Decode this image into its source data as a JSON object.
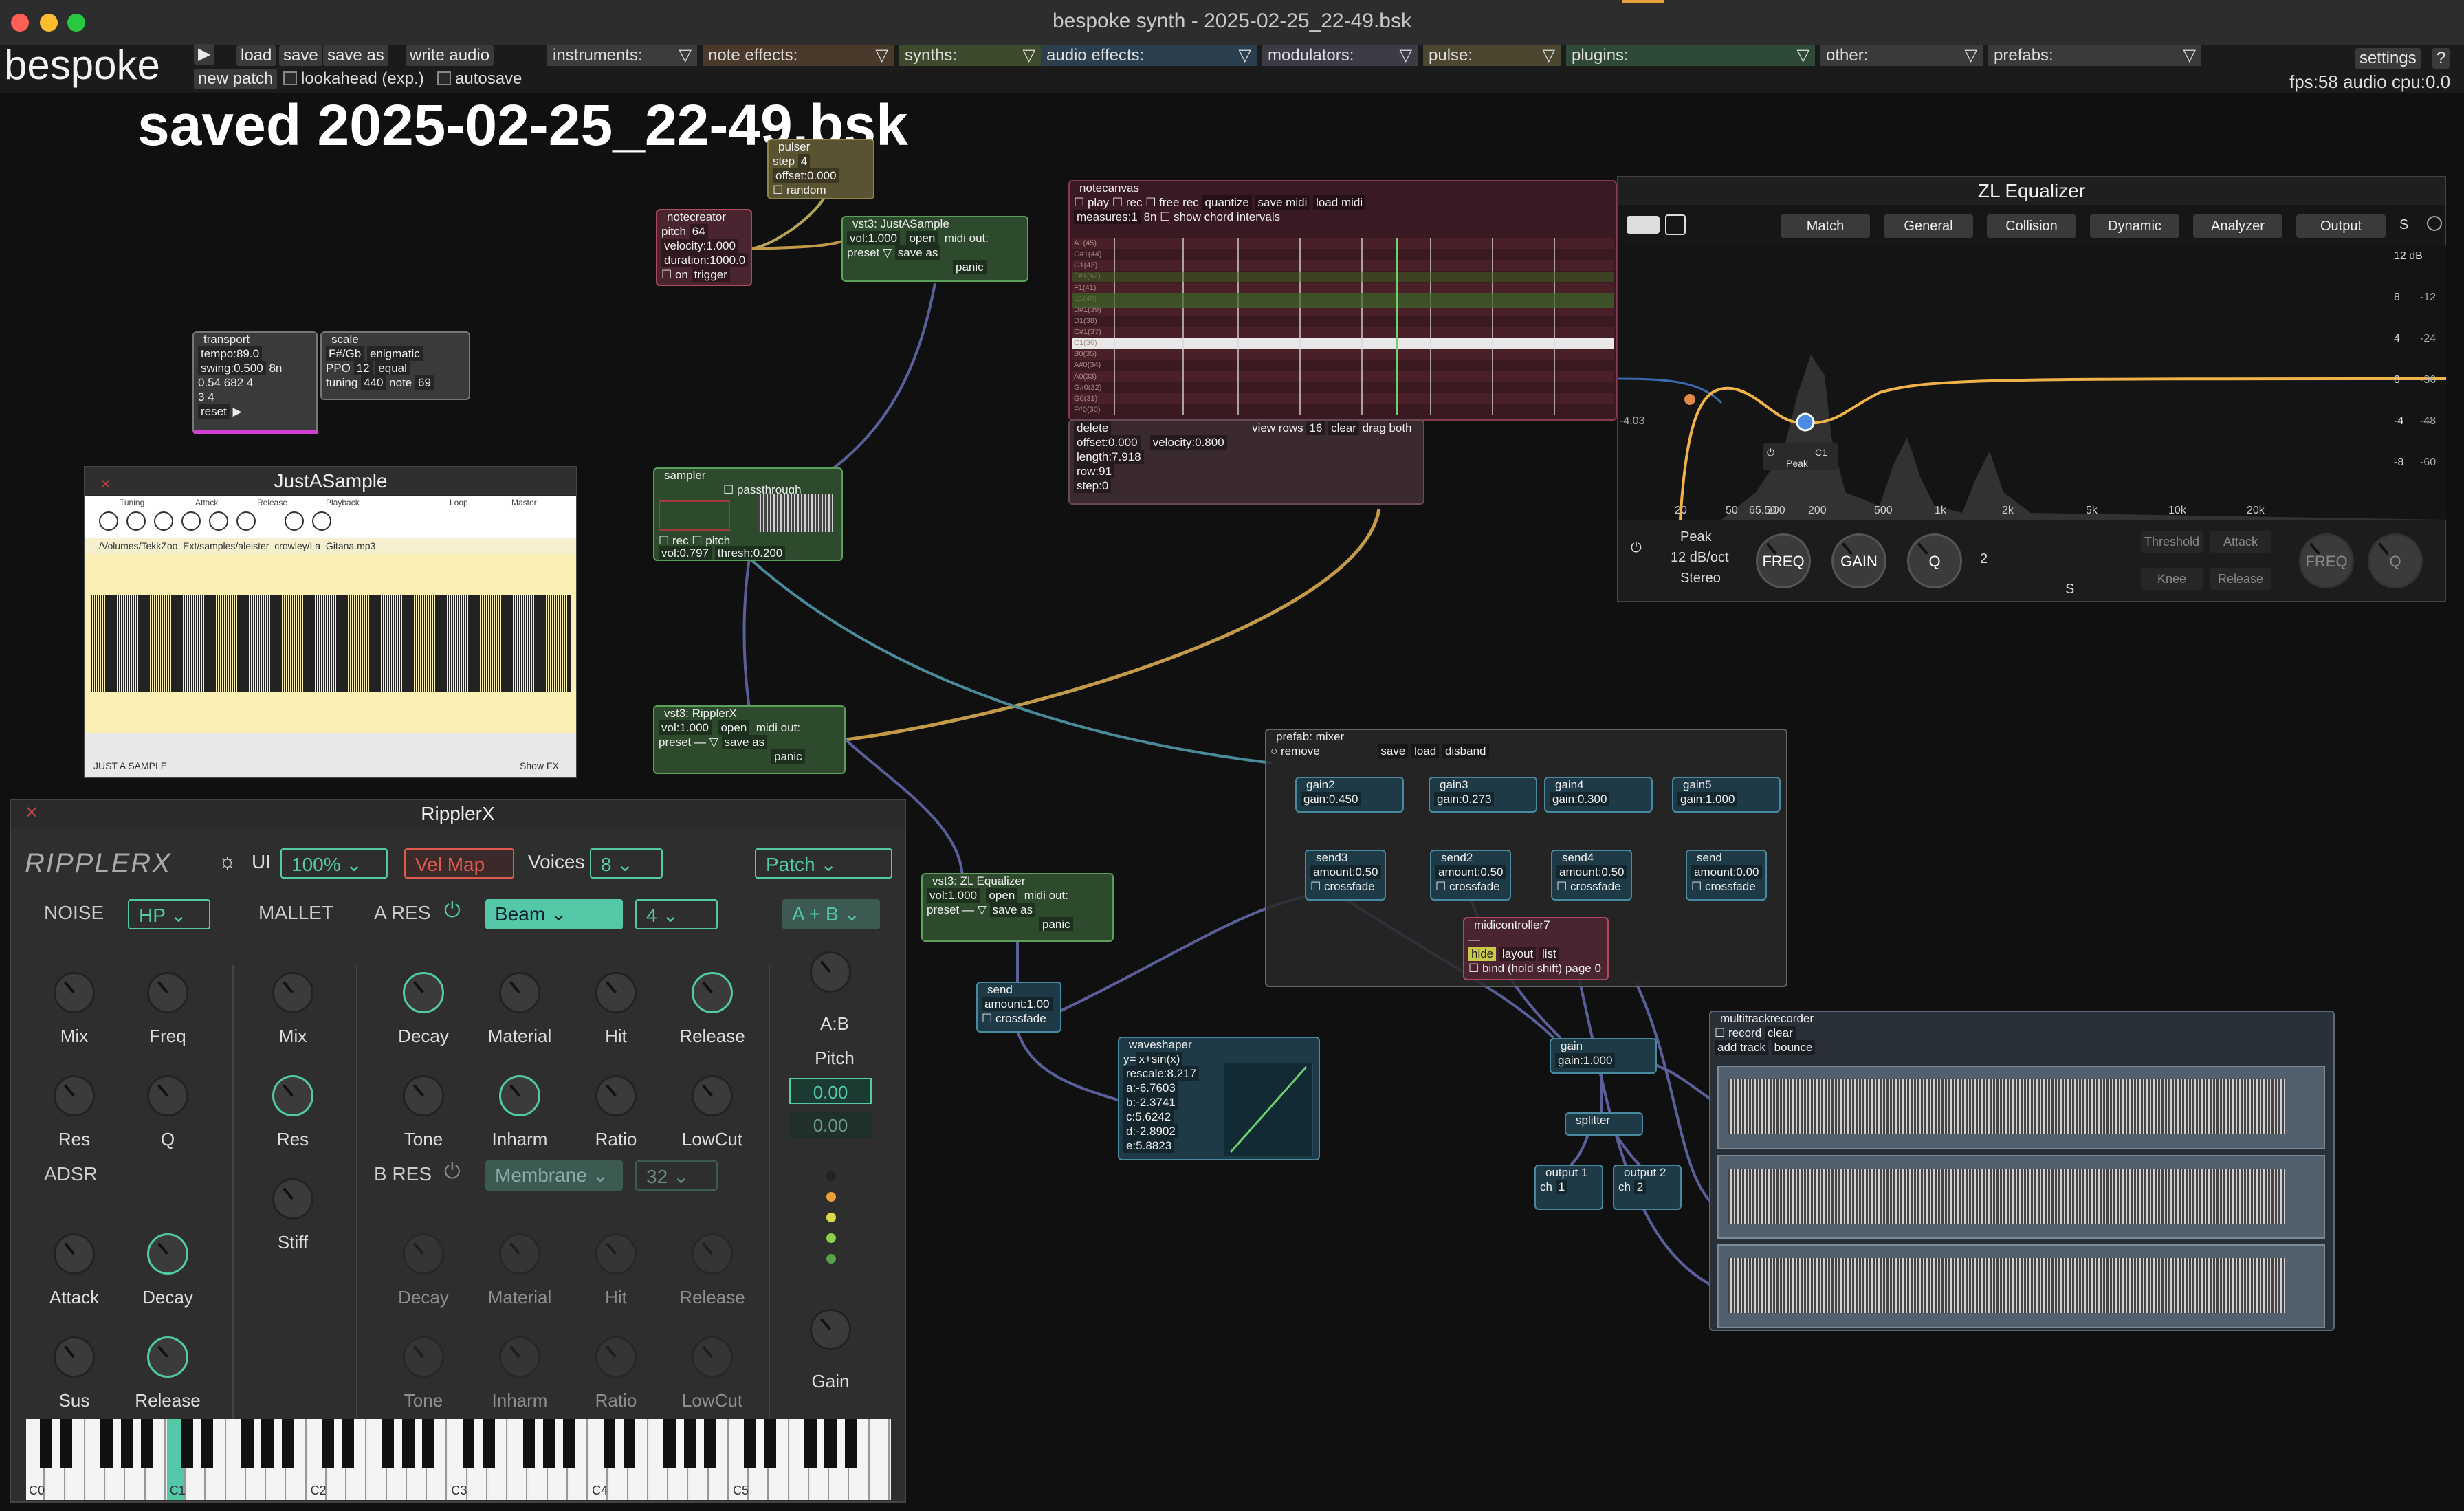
{
  "window": {
    "title": "bespoke synth - 2025-02-25_22-49.bsk"
  },
  "toolbar": {
    "logo": "bespoke",
    "play_icon": "play-icon",
    "load": "load",
    "save": "save",
    "save_as": "save as",
    "write_audio": "write audio",
    "new_patch": "new patch",
    "lookahead": "lookahead (exp.)",
    "autosave": "autosave",
    "menus": [
      "instruments:",
      "note effects:",
      "synths:",
      "audio effects:",
      "modulators:",
      "pulse:",
      "plugins:",
      "other:",
      "prefabs:"
    ],
    "settings": "settings",
    "help": "?",
    "stats": "fps:58  audio cpu:0.0"
  },
  "canvas": {
    "saved_banner": "saved 2025-02-25_22-49.bsk"
  },
  "modules": {
    "pulser": {
      "title": "pulser",
      "step": "step",
      "step_val": "4",
      "offset": "offset:0.000",
      "random": "random"
    },
    "notecreator": {
      "title": "notecreator",
      "pitch": "pitch",
      "pitch_val": "64",
      "velocity": "velocity:1.000",
      "duration": "duration:1000.0",
      "on": "on",
      "trigger": "trigger"
    },
    "vst_justasample": {
      "title": "vst3: JustASample",
      "vol": "vol:1.000",
      "open": "open",
      "midi_out": "midi out:",
      "preset": "preset",
      "save_as": "save as",
      "panic": "panic"
    },
    "transport": {
      "title": "transport",
      "tempo": "tempo:89.0",
      "swing": "swing:0.500",
      "swing_div": "8n",
      "val1": "0.54 682",
      "val2": "3",
      "n1": "4",
      "n2": "4",
      "reset": "reset"
    },
    "scale": {
      "title": "scale",
      "root": "F#/Gb",
      "mode": "enigmatic",
      "ppo": "PPO",
      "ppo_val": "12",
      "tuning_sys": "equal",
      "tuning": "tuning",
      "tuning_val": "440",
      "note": "note",
      "note_val": "69"
    },
    "sampler": {
      "title": "sampler",
      "passthrough": "passthrough",
      "rec": "rec",
      "pitch": "pitch",
      "vol": "vol:0.797",
      "thresh": "thresh:0.200"
    },
    "vst_ripplerx": {
      "title": "vst3: RipplerX",
      "vol": "vol:1.000",
      "open": "open",
      "midi_out": "midi out:",
      "preset": "preset",
      "preset_val": "—",
      "save_as": "save as",
      "panic": "panic"
    },
    "vst_zleq": {
      "title": "vst3: ZL Equalizer",
      "vol": "vol:1.000",
      "open": "open",
      "midi_out": "midi out:",
      "preset": "preset",
      "preset_val": "—",
      "save_as": "save as",
      "panic": "panic"
    },
    "send_main": {
      "title": "send",
      "amount": "amount:1.00",
      "crossfade": "crossfade"
    },
    "waveshaper": {
      "title": "waveshaper",
      "y": "y=",
      "expr": "x+sin(x)",
      "rescale": "rescale:8.217",
      "a": "a:-6.7603",
      "b": "b:-2.3741",
      "c": "c:5.6242",
      "d": "d:-2.8902",
      "e": "e:5.8823"
    },
    "notecanvas": {
      "title": "notecanvas",
      "play": "play",
      "rec": "rec",
      "free_rec": "free rec",
      "quantize": "quantize",
      "save_midi": "save midi",
      "load_midi": "load midi",
      "measures": "measures:1",
      "div": "8n",
      "show_chord": "show chord intervals",
      "rows": [
        "A1(45)",
        "G#1(44)",
        "G1(43)",
        "F#1(42)",
        "F1(41)",
        "E1(40)",
        "D#1(39)",
        "D1(38)",
        "C#1(37)",
        "C1(36)",
        "B0(35)",
        "A#0(34)",
        "A0(33)",
        "G#0(32)",
        "G0(31)",
        "F#0(30)"
      ],
      "delete": "delete",
      "view_rows": "view rows",
      "view_rows_val": "16",
      "clear": "clear",
      "drag_both": "drag both",
      "offset": "offset:0.000",
      "velocity": "velocity:0.800",
      "length": "length:7.918",
      "row": "row:91",
      "step": "step:0"
    },
    "mixer": {
      "title": "prefab: mixer",
      "remove": "remove",
      "save": "save",
      "load": "load",
      "disband": "disband",
      "gains": [
        {
          "title": "gain2",
          "val": "gain:0.450"
        },
        {
          "title": "gain3",
          "val": "gain:0.273"
        },
        {
          "title": "gain4",
          "val": "gain:0.300"
        },
        {
          "title": "gain5",
          "val": "gain:1.000"
        }
      ],
      "sends": [
        {
          "title": "send3",
          "amount": "amount:0.50",
          "crossfade": "crossfade"
        },
        {
          "title": "send2",
          "amount": "amount:0.50",
          "crossfade": "crossfade"
        },
        {
          "title": "send4",
          "amount": "amount:0.50",
          "crossfade": "crossfade"
        },
        {
          "title": "send",
          "amount": "amount:0.00",
          "crossfade": "crossfade"
        }
      ],
      "midicontroller": {
        "title": "midicontroller7",
        "val": "—",
        "hide": "hide",
        "layout": "layout",
        "list": "list",
        "bind": "bind (hold shift)",
        "page": "page 0"
      }
    },
    "gain_out": {
      "title": "gain",
      "val": "gain:1.000"
    },
    "splitter": {
      "title": "splitter"
    },
    "output1": {
      "title": "output 1",
      "ch": "ch",
      "ch_val": "1"
    },
    "output2": {
      "title": "output 2",
      "ch": "ch",
      "ch_val": "2"
    },
    "recorder": {
      "title": "multitrackrecorder",
      "record": "record",
      "clear": "clear",
      "add_track": "add track",
      "bounce": "bounce"
    }
  },
  "justasample": {
    "title": "JustASample",
    "sections": [
      "Tuning",
      "Attack",
      "Release",
      "Playback",
      "Loop",
      "Master"
    ],
    "path": "/Volumes/TekkZoo_Ext/samples/aleister_crowley/La_Gitana.mp3",
    "footer": "JUST A SAMPLE",
    "show_fx": "Show FX"
  },
  "zleq": {
    "title": "ZL Equalizer",
    "tabs": [
      "Match",
      "General",
      "Collision",
      "Dynamic",
      "Analyzer",
      "Output"
    ],
    "s_label": "S",
    "db_right": [
      "12 dB",
      "8",
      "4",
      "0",
      "-4",
      "-8"
    ],
    "db_far": [
      "-12",
      "-24",
      "-36",
      "-48",
      "-60"
    ],
    "left_readout": "-4.03",
    "freqs": [
      "20",
      "50",
      "65.50",
      "100",
      "200",
      "500",
      "1k",
      "2k",
      "5k",
      "10k",
      "20k"
    ],
    "band": "C1",
    "peak_tag": "Peak",
    "filter_type": "Peak",
    "slope": "12 dB/oct",
    "mode": "Stereo",
    "knobs": [
      "FREQ",
      "GAIN",
      "Q"
    ],
    "band_num": "2",
    "dyn": [
      "Threshold",
      "Attack",
      "Knee",
      "Release"
    ],
    "dyn_knobs": [
      "FREQ",
      "Q"
    ],
    "s_btn": "S"
  },
  "ripplerx": {
    "title": "RipplerX",
    "logo": "RIPPLERX",
    "ui": "UI",
    "ui_zoom": "100%",
    "vel_map": "Vel Map",
    "voices": "Voices",
    "voices_val": "8",
    "patch": "Patch",
    "noise": "NOISE",
    "noise_filter": "HP",
    "mallet": "MALLET",
    "a_res": "A RES",
    "a_model": "Beam",
    "a_partials": "4",
    "ab_mode": "A + B",
    "b_res": "B RES",
    "b_model": "Membrane",
    "b_partials": "32",
    "adsr": "ADSR",
    "noise_knobs": [
      "Mix",
      "Freq",
      "Res",
      "Q"
    ],
    "mallet_knobs": [
      "Mix",
      "Res",
      "Stiff"
    ],
    "a_knobs": [
      "Decay",
      "Material",
      "Hit",
      "Release",
      "Tone",
      "Inharm",
      "Ratio",
      "LowCut"
    ],
    "b_knobs": [
      "Decay",
      "Material",
      "Hit",
      "Release",
      "Tone",
      "Inharm",
      "Ratio",
      "LowCut"
    ],
    "adsr_knobs": [
      "Attack",
      "Decay",
      "Sus",
      "Release"
    ],
    "ab": "A:B",
    "pitch": "Pitch",
    "pitch_a": "0.00",
    "pitch_b": "0.00",
    "gain": "Gain",
    "octaves": [
      "C0",
      "C1",
      "C2",
      "C3",
      "C4",
      "C5"
    ],
    "colors": {
      "accent": "#53c9a8",
      "vel": "#e0594e"
    }
  }
}
